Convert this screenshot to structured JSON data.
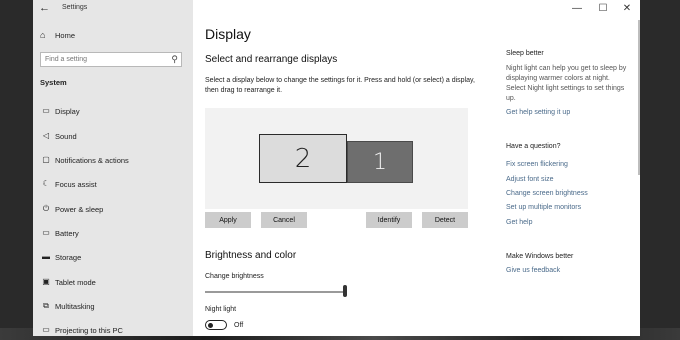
{
  "window": {
    "back_glyph": "←",
    "title": "Settings",
    "controls": {
      "minimize": "—",
      "maximize": "☐",
      "close": "✕"
    }
  },
  "sidebar": {
    "home": {
      "icon": "home-icon",
      "glyph": "⌂",
      "label": "Home"
    },
    "search": {
      "placeholder": "Find a setting",
      "icon": "search-icon",
      "glyph": "⚲"
    },
    "section": "System",
    "items": [
      {
        "label": "Display",
        "icon": "monitor-icon",
        "glyph": "▭"
      },
      {
        "label": "Sound",
        "icon": "speaker-icon",
        "glyph": "◁"
      },
      {
        "label": "Notifications & actions",
        "icon": "notifications-icon",
        "glyph": "▢"
      },
      {
        "label": "Focus assist",
        "icon": "moon-icon",
        "glyph": "☾"
      },
      {
        "label": "Power & sleep",
        "icon": "power-icon",
        "glyph": "⏻"
      },
      {
        "label": "Battery",
        "icon": "battery-icon",
        "glyph": "▭"
      },
      {
        "label": "Storage",
        "icon": "storage-icon",
        "glyph": "▬"
      },
      {
        "label": "Tablet mode",
        "icon": "tablet-icon",
        "glyph": "▣"
      },
      {
        "label": "Multitasking",
        "icon": "multitasking-icon",
        "glyph": "⧉"
      },
      {
        "label": "Projecting to this PC",
        "icon": "projecting-icon",
        "glyph": "▭"
      }
    ]
  },
  "main": {
    "title": "Display",
    "arrange_heading": "Select and rearrange displays",
    "arrange_desc": "Select a display below to change the settings for it. Press and hold (or select) a display, then drag to rearrange it.",
    "monitors": [
      {
        "number": "2"
      },
      {
        "number": "1"
      }
    ],
    "buttons": {
      "apply": "Apply",
      "cancel": "Cancel",
      "identify": "Identify",
      "detect": "Detect"
    },
    "brightness_heading": "Brightness and color",
    "brightness_label": "Change brightness",
    "brightness_value": 1.0,
    "night_light_label": "Night light",
    "night_light_state": "Off"
  },
  "related": {
    "sleep_heading": "Sleep better",
    "sleep_text": "Night light can help you get to sleep by displaying warmer colors at night. Select Night light settings to set things up.",
    "sleep_link": "Get help setting it up",
    "question_heading": "Have a question?",
    "question_links": [
      "Fix screen flickering",
      "Adjust font size",
      "Change screen brightness",
      "Set up multiple monitors",
      "Get help"
    ],
    "better_heading": "Make Windows better",
    "better_link": "Give us feedback"
  },
  "colors": {
    "sidebar_bg": "#e6e6e6",
    "button_bg": "#cccccc",
    "link": "#4a6a8a",
    "selected_monitor": "#6e6e6e"
  }
}
